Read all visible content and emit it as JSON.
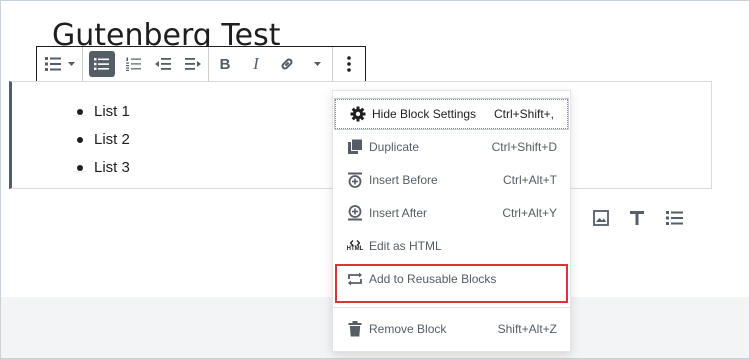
{
  "post": {
    "title": "Gutenberg Test"
  },
  "toolbar": {
    "block_type": "list-icon",
    "buttons": [
      {
        "name": "unordered-list",
        "icon": "unordered-list-icon",
        "active": true
      },
      {
        "name": "ordered-list",
        "icon": "ordered-list-icon",
        "active": false
      },
      {
        "name": "outdent",
        "icon": "outdent-icon",
        "active": false
      },
      {
        "name": "indent",
        "icon": "indent-icon",
        "active": false
      }
    ],
    "bold_label": "B",
    "italic_label": "I"
  },
  "list_block": {
    "items": [
      "List 1",
      "List 2",
      "List 3"
    ]
  },
  "inserter_shortcuts": [
    "image-icon",
    "heading-icon",
    "list-icon"
  ],
  "more_menu": {
    "items": [
      {
        "label": "Hide Block Settings",
        "shortcut": "Ctrl+Shift+,",
        "icon": "gear-icon"
      },
      {
        "label": "Duplicate",
        "shortcut": "Ctrl+Shift+D",
        "icon": "duplicate-icon"
      },
      {
        "label": "Insert Before",
        "shortcut": "Ctrl+Alt+T",
        "icon": "insert-before-icon"
      },
      {
        "label": "Insert After",
        "shortcut": "Ctrl+Alt+Y",
        "icon": "insert-after-icon"
      },
      {
        "label": "Edit as HTML",
        "shortcut": "",
        "icon": "html-icon"
      },
      {
        "label": "Add to Reusable Blocks",
        "shortcut": "",
        "icon": "reusable-block-icon"
      },
      {
        "label": "Remove Block",
        "shortcut": "Shift+Alt+Z",
        "icon": "trash-icon"
      }
    ],
    "html_icon_text": "HTML"
  },
  "colors": {
    "highlight": "#d63638",
    "text": "#1e1e1e",
    "muted": "#555d66"
  }
}
